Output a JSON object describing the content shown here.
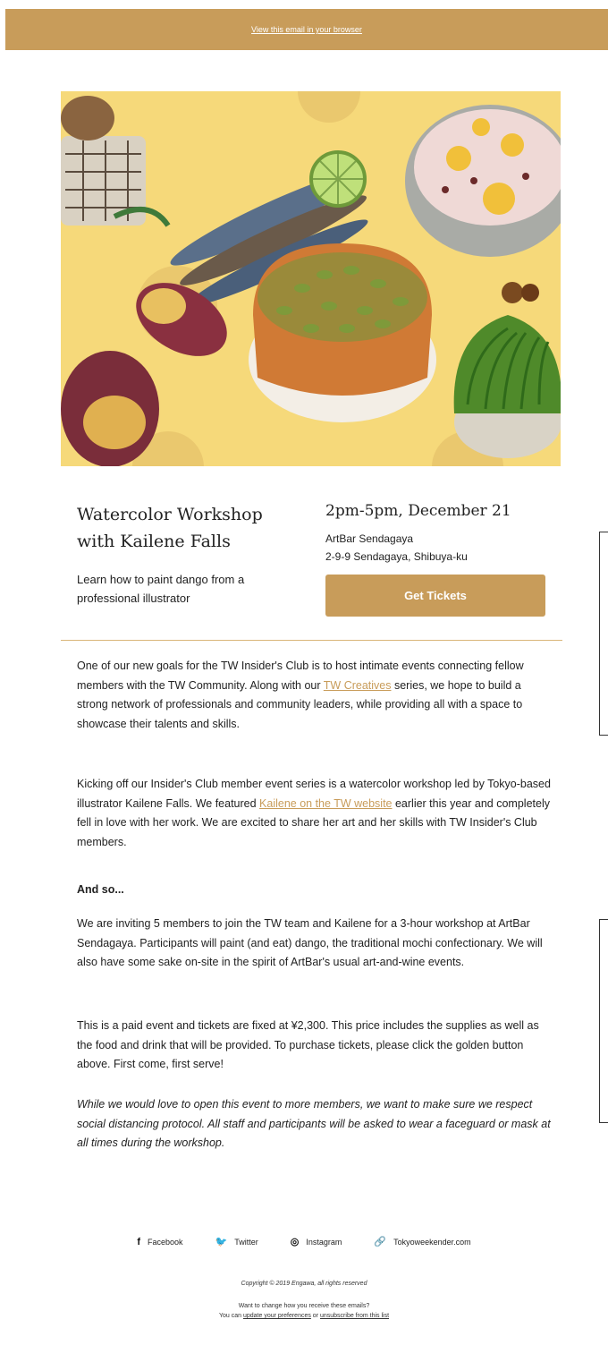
{
  "header": {
    "view_in_browser": "View this email in your browser"
  },
  "event": {
    "title_line1": "Watercolor Workshop",
    "title_line2": "with Kailene Falls",
    "summary": "Learn how to paint dango from a professional illustrator",
    "when": "2pm-5pm, December 21",
    "venue_name": "ArtBar Sendagaya",
    "venue_address": "2-9-9 Sendagaya, Shibuya-ku",
    "button_label": "Get Tickets"
  },
  "body": {
    "p1_a": "One of our new goals for the TW Insider's Club is to host intimate events connecting fellow members with the TW Community. Along with our ",
    "p1_link": "TW Creatives",
    "p1_b": " series, we hope to build a strong network of professionals and community leaders, while providing all with a space to showcase their talents and skills.",
    "p2_a": "Kicking off our Insider's Club member event series is a watercolor workshop led by Tokyo-based illustrator Kailene Falls. We featured ",
    "p2_link": "Kailene on the TW website",
    "p2_b": " earlier this year and completely fell in love with her work. We are excited to share her art and her skills with TW Insider's Club members.",
    "heading": "And so...",
    "p4": "We are inviting 5 members to join the TW team and Kailene for a 3-hour workshop at ArtBar Sendagaya. Participants will paint (and eat) dango, the traditional mochi confectionary. We will also have some sake on-site in the spirit of ArtBar's usual art-and-wine events.",
    "p5": "This is a paid event and tickets are fixed at ¥2,300. This price includes the supplies as well as the food and drink that will be provided. To purchase tickets, please click the golden button above. First come, first serve!",
    "p6": "While we would love to open this event to more members, we want to make sure we respect social distancing protocol. All staff and participants will be asked to wear a faceguard or mask at all times during the workshop."
  },
  "footer": {
    "social": [
      {
        "label": "Facebook",
        "icon": "facebook-icon",
        "glyph": "f"
      },
      {
        "label": "Twitter",
        "icon": "twitter-icon",
        "glyph": "🐦"
      },
      {
        "label": "Instagram",
        "icon": "instagram-icon",
        "glyph": "◎"
      },
      {
        "label": "Tokyoweekender.com",
        "icon": "link-icon",
        "glyph": "🔗"
      }
    ],
    "copyright": "Copyright © 2019 Engawa, all rights reserved",
    "pref_line1": "Want to change how you receive these emails?",
    "pref_prefix": "You can ",
    "pref_link1": "update your preferences",
    "pref_mid": " or ",
    "pref_link2": "unsubscribe from this list"
  },
  "colors": {
    "accent": "#c89c5a",
    "hero_bg": "#f6d97a"
  }
}
